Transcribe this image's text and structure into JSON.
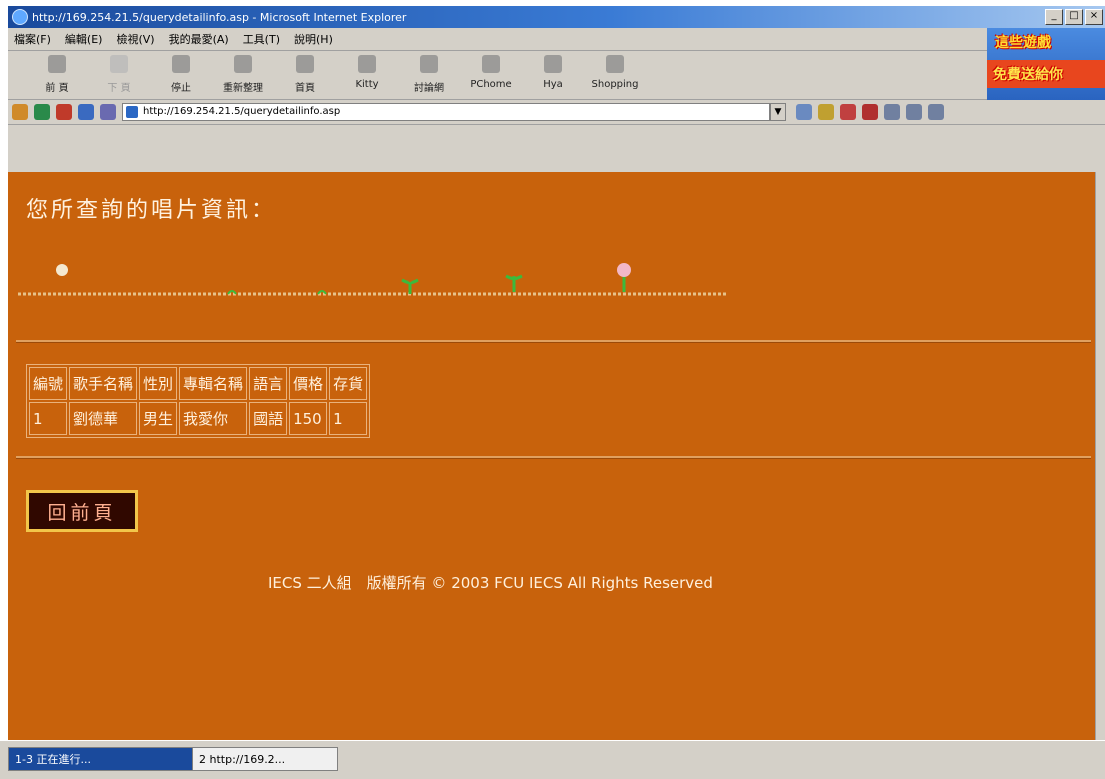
{
  "window": {
    "title": "http://169.254.21.5/querydetailinfo.asp - Microsoft Internet Explorer",
    "controls": [
      "_",
      "□",
      "×"
    ]
  },
  "menubar": {
    "items": [
      "檔案(F)",
      "編輯(E)",
      "檢視(V)",
      "我的最愛(A)",
      "工具(T)",
      "說明(H)"
    ]
  },
  "toolbar": {
    "buttons": [
      {
        "label": "前 頁",
        "enabled": true
      },
      {
        "label": "下 頁",
        "enabled": false
      },
      {
        "label": "停止",
        "enabled": true
      },
      {
        "label": "重新整理",
        "enabled": true
      },
      {
        "label": "首頁",
        "enabled": true
      },
      {
        "label": "Kitty",
        "enabled": true
      },
      {
        "label": "討論網",
        "enabled": true
      },
      {
        "label": "PChome",
        "enabled": true
      },
      {
        "label": "Hya",
        "enabled": true
      },
      {
        "label": "Shopping",
        "enabled": true
      }
    ]
  },
  "ad": {
    "line1": "這些遊戲",
    "line2": "免費送給你"
  },
  "address": {
    "url": "http://169.254.21.5/querydetailinfo.asp"
  },
  "page": {
    "heading": "您所查詢的唱片資訊：",
    "table": {
      "headers": [
        "編號",
        "歌手名稱",
        "性別",
        "專輯名稱",
        "語言",
        "價格",
        "存貨"
      ],
      "rows": [
        [
          "1",
          "劉德華",
          "男生",
          "我愛你",
          "國語",
          "150",
          "1"
        ]
      ]
    },
    "back_button": "回前頁",
    "footer": "IECS 二人組　版權所有 © 2003 FCU IECS All Rights Reserved"
  },
  "taskbar": {
    "tasks": [
      "1-3 正在進行...",
      "2 http://169.2..."
    ]
  },
  "colors": {
    "page_bg": "#c8620c",
    "text": "#fff0dc"
  }
}
